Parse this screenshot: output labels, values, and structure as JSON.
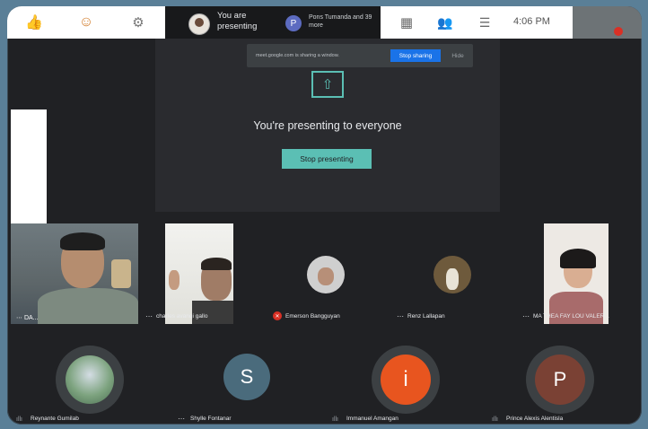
{
  "topbar": {
    "presenting_text": "You are presenting",
    "participants_avatar_letter": "P",
    "participants_text": "Pons Tumanda and 39 more",
    "time": "4:06 PM",
    "thumb_label": "",
    "icons": [
      "thumbs-up-icon",
      "emoji-icon",
      "gear-icon",
      "qr-icon",
      "people-icon",
      "chat-icon"
    ]
  },
  "share_bar": {
    "text": "meet.google.com is sharing a window.",
    "stop_sharing": "Stop sharing",
    "hide": "Hide"
  },
  "present": {
    "title": "You're presenting to everyone",
    "button": "Stop presenting"
  },
  "participants_row1": [
    {
      "name": "DA...",
      "type": "video"
    },
    {
      "name": "charles avanqi gallo",
      "type": "video"
    },
    {
      "name": "Emerson Bangguyan",
      "type": "avatar"
    },
    {
      "name": "Renz Lallapan",
      "type": "avatar"
    },
    {
      "name": "MA THEA FAY LOU VALER...",
      "type": "video"
    }
  ],
  "participants_row2": [
    {
      "name": "Reynante Gumilab",
      "letter": ""
    },
    {
      "name": "Shylle Fontanar",
      "letter": "S"
    },
    {
      "name": "Immanuel Amangan",
      "letter": "i"
    },
    {
      "name": "Prince Alexis Alentisla",
      "letter": "P"
    }
  ],
  "colors": {
    "accent_teal": "#5bbfb4",
    "stop_sharing_blue": "#1a73e8",
    "muted_red": "#d93025",
    "background": "#202124"
  }
}
